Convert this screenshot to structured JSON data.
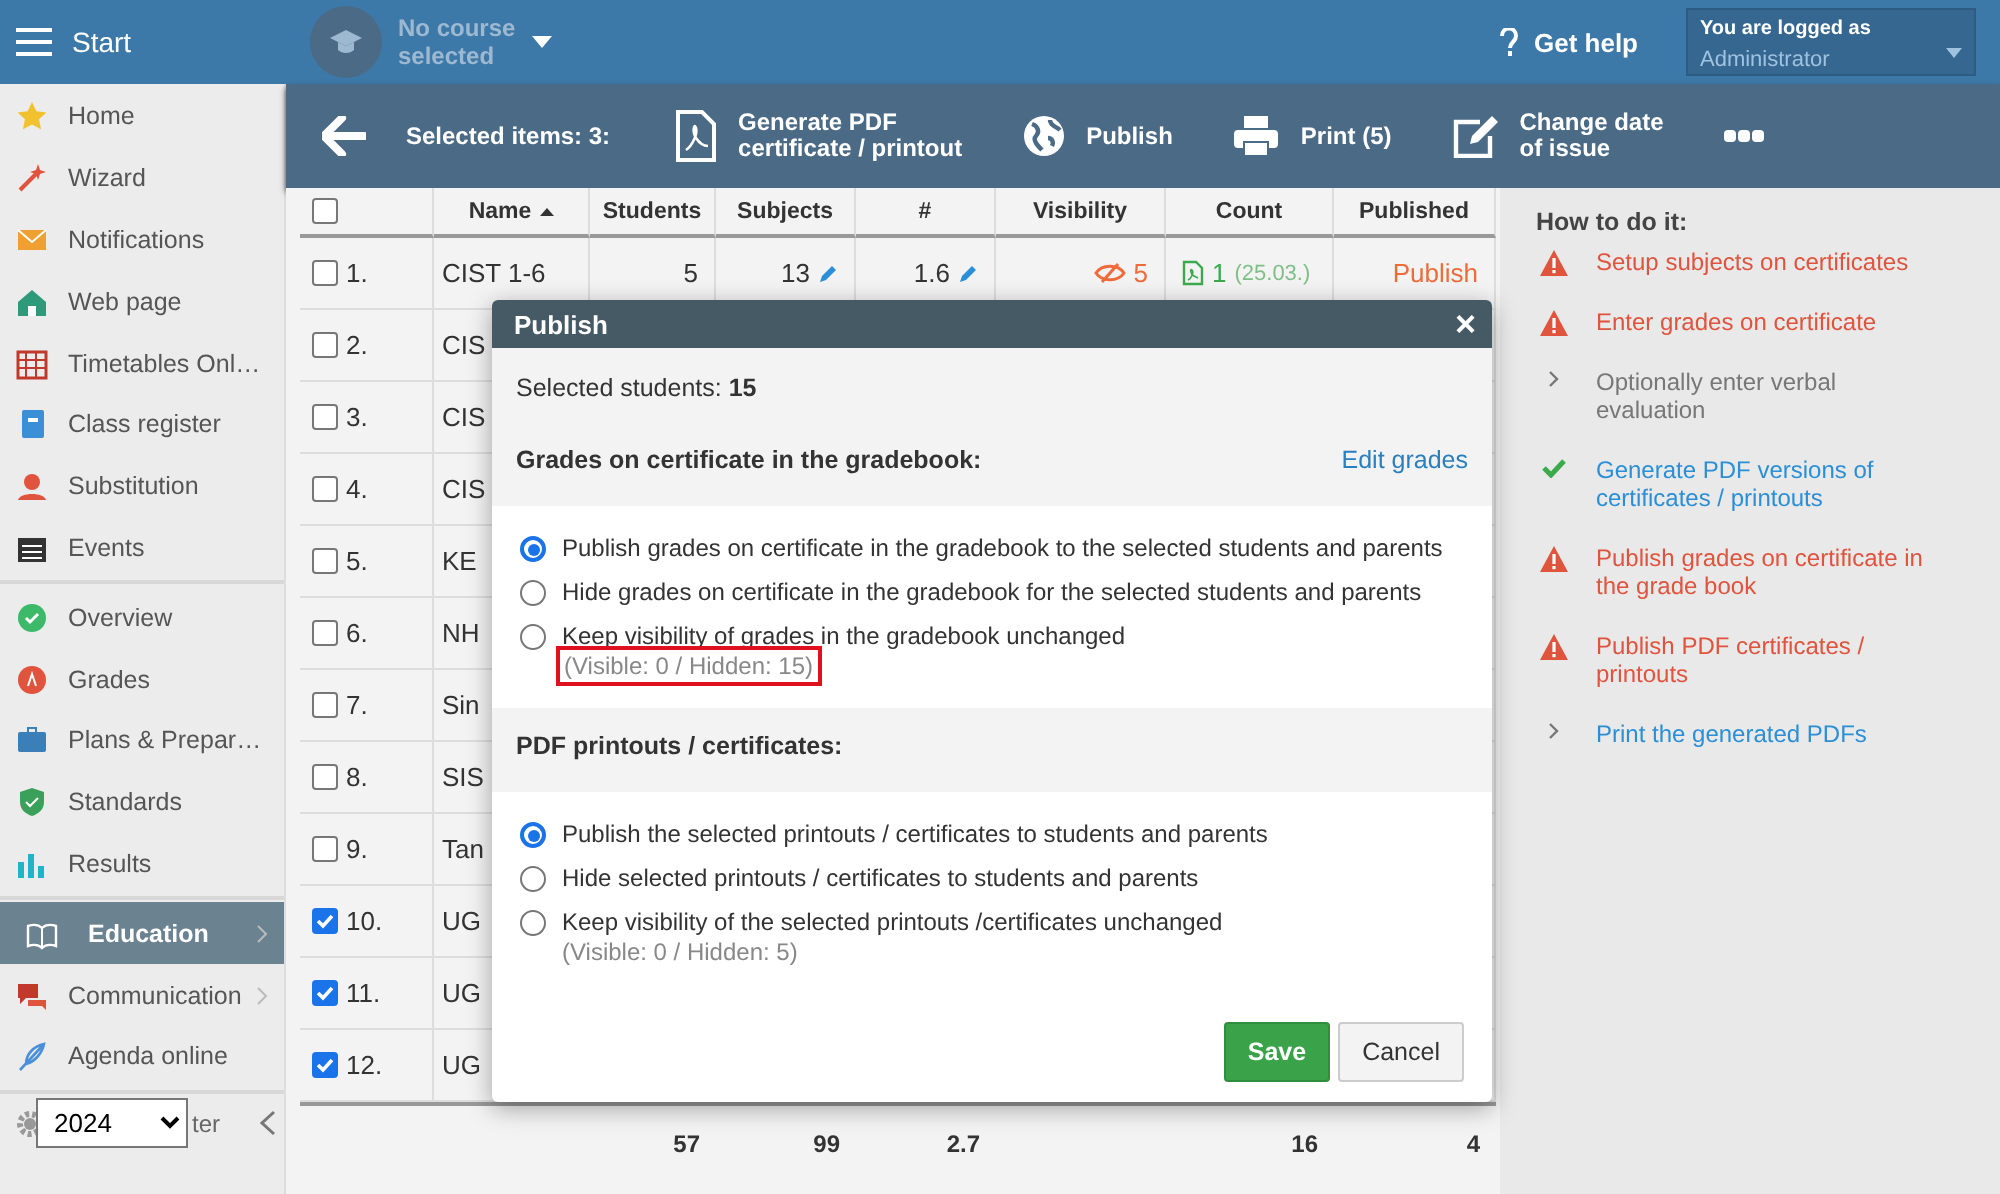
{
  "topbar": {
    "start": "Start",
    "course": {
      "lines": [
        "No course",
        "selected"
      ]
    },
    "help": "Get help",
    "login": {
      "label": "You are logged as",
      "user": "Administrator"
    }
  },
  "sidebar": {
    "groups": [
      [
        {
          "label": "Home",
          "selected": false,
          "expandable": false
        },
        {
          "label": "Wizard",
          "selected": false,
          "expandable": false
        },
        {
          "label": "Notifications",
          "selected": false,
          "expandable": false
        },
        {
          "label": "Web page",
          "selected": false,
          "expandable": false
        },
        {
          "label": "Timetables Onl…",
          "selected": false,
          "expandable": false
        },
        {
          "label": "Class register",
          "selected": false,
          "expandable": false
        },
        {
          "label": "Substitution",
          "selected": false,
          "expandable": false
        },
        {
          "label": "Events",
          "selected": false,
          "expandable": false
        }
      ],
      [
        {
          "label": "Overview",
          "selected": false,
          "expandable": false
        },
        {
          "label": "Grades",
          "selected": false,
          "expandable": false
        },
        {
          "label": "Plans & Prepar…",
          "selected": false,
          "expandable": false
        },
        {
          "label": "Standards",
          "selected": false,
          "expandable": false
        },
        {
          "label": "Results",
          "selected": false,
          "expandable": false
        }
      ],
      [
        {
          "label": "Education",
          "selected": true,
          "expandable": true
        },
        {
          "label": "Communication",
          "selected": false,
          "expandable": true
        },
        {
          "label": "Agenda online",
          "selected": false,
          "expandable": false
        }
      ]
    ],
    "footer_label": "ter",
    "year": "2024"
  },
  "toolbar": {
    "selected_items": "Selected items: 3:",
    "actions": [
      {
        "lines": [
          "Generate PDF",
          "certificate / printout"
        ]
      },
      {
        "lines": [
          "Publish"
        ]
      },
      {
        "lines": [
          "Print (5)"
        ]
      },
      {
        "lines": [
          "Change date",
          "of issue"
        ]
      }
    ]
  },
  "table": {
    "header_checked": false,
    "columns": [
      "Name",
      "Students",
      "Subjects",
      "#",
      "Visibility",
      "Count",
      "Published"
    ],
    "rows": [
      {
        "number": "1.",
        "name": "CIST 1-6",
        "selected": false,
        "students": "5",
        "subjects": "13",
        "average": "1.6",
        "visibility": "5",
        "count": "1",
        "date": "(25.03.)",
        "published": "Publish"
      },
      {
        "number": "2.",
        "name": "CIS",
        "selected": false
      },
      {
        "number": "3.",
        "name": "CIS",
        "selected": false
      },
      {
        "number": "4.",
        "name": "CIS",
        "selected": false
      },
      {
        "number": "5.",
        "name": "KE",
        "selected": false
      },
      {
        "number": "6.",
        "name": "NH",
        "selected": false
      },
      {
        "number": "7.",
        "name": "Sin",
        "selected": false
      },
      {
        "number": "8.",
        "name": "SIS",
        "selected": false
      },
      {
        "number": "9.",
        "name": "Tan",
        "selected": false
      },
      {
        "number": "10.",
        "name": "UG",
        "selected": true
      },
      {
        "number": "11.",
        "name": "UG",
        "selected": true
      },
      {
        "number": "12.",
        "name": "UG",
        "selected": true
      }
    ],
    "totals": {
      "students": "57",
      "subjects": "99",
      "average": "2.7",
      "count": "16",
      "published": "4"
    }
  },
  "help_panel": {
    "title": "How to do it:",
    "steps": [
      {
        "kind": "warning",
        "text": "Setup subjects on certificates"
      },
      {
        "kind": "warning",
        "text": "Enter grades on certificate"
      },
      {
        "kind": "optional",
        "text": "Optionally enter verbal evaluation"
      },
      {
        "kind": "done",
        "text": "Generate PDF versions of certificates / printouts"
      },
      {
        "kind": "warning",
        "text": "Publish grades on certificate in the grade book"
      },
      {
        "kind": "warning",
        "text": "Publish PDF certificates / printouts"
      },
      {
        "kind": "link",
        "text": "Print the generated PDFs"
      }
    ]
  },
  "dialog": {
    "title": "Publish",
    "close": "×",
    "summary": "Selected students: **15**",
    "sections": [
      {
        "title": "Grades on certificate in the gradebook:",
        "link": "Edit grades",
        "options": [
          {
            "label": "Publish grades on certificate in the gradebook to the selected students and parents",
            "selected": true
          },
          {
            "label": "Hide grades on certificate in the gradebook for the selected students and parents",
            "selected": false
          },
          {
            "label": "Keep visibility of grades in the gradebook unchanged",
            "selected": false,
            "note": "(Visible: 0 / Hidden: 15)",
            "highlighted": true
          }
        ]
      },
      {
        "title": "PDF printouts / certificates:",
        "options": [
          {
            "label": "Publish the selected printouts / certificates to students and parents",
            "selected": true
          },
          {
            "label": "Hide selected printouts / certificates to students and parents",
            "selected": false
          },
          {
            "label": "Keep visibility of the selected printouts /certificates unchanged",
            "selected": false,
            "note": "(Visible: 0 / Hidden: 5)",
            "highlighted": false
          }
        ]
      }
    ],
    "buttons": [
      {
        "kind": "primary",
        "label": "Save"
      },
      {
        "kind": "secondary",
        "label": "Cancel"
      }
    ]
  }
}
